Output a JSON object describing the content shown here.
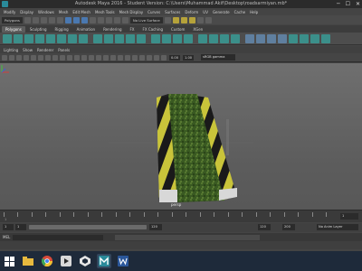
{
  "window": {
    "title": "Autodesk Maya 2016 - Student Version: C:\\Users\\Muhammad Akif\\Desktop\\roadsarmiyan.mb*",
    "controls": [
      "─",
      "☐",
      "✕"
    ]
  },
  "menubar": [
    "Modify",
    "Display",
    "Windows",
    "Mesh",
    "Edit Mesh",
    "Mesh Tools",
    "Mesh Display",
    "Curves",
    "Surfaces",
    "Deform",
    "UV",
    "Generate",
    "Cache",
    "Help"
  ],
  "toolbar": {
    "mode": "Polygons",
    "live_surface": "No Live Surface"
  },
  "shelf_tabs": [
    {
      "label": "Polygons",
      "active": true
    },
    {
      "label": "Sculpting"
    },
    {
      "label": "Rigging"
    },
    {
      "label": "Animation"
    },
    {
      "label": "Rendering"
    },
    {
      "label": "FX"
    },
    {
      "label": "FX Caching"
    },
    {
      "label": "Custom"
    },
    {
      "label": "XGen"
    }
  ],
  "panel_menu": [
    "Lighting",
    "Show",
    "Renderer",
    "Panels"
  ],
  "panel_toolbar": {
    "field_a": "0.00",
    "field_b": "1.00",
    "color_space": "sRGB gamma"
  },
  "viewport": {
    "camera_label": "persp"
  },
  "timeline": {
    "ticks": [
      "1",
      "",
      "",
      "",
      "",
      "",
      "",
      "",
      "",
      "",
      "",
      "",
      "",
      "",
      "",
      "",
      "",
      "",
      "",
      "",
      "",
      "",
      "",
      ""
    ],
    "current_frame": "1"
  },
  "range": {
    "start_left": "1",
    "start_inner": "1",
    "end_inner": "120",
    "end_outer": "120",
    "end_max": "200",
    "anim_layer": "No Anim Layer"
  },
  "cmdline": {
    "label": "MEL"
  },
  "taskbar": {
    "icons": [
      "windows-logo-icon",
      "explorer-icon",
      "chrome-icon",
      "media-icon",
      "unity-icon",
      "maya-icon",
      "word-icon"
    ]
  }
}
